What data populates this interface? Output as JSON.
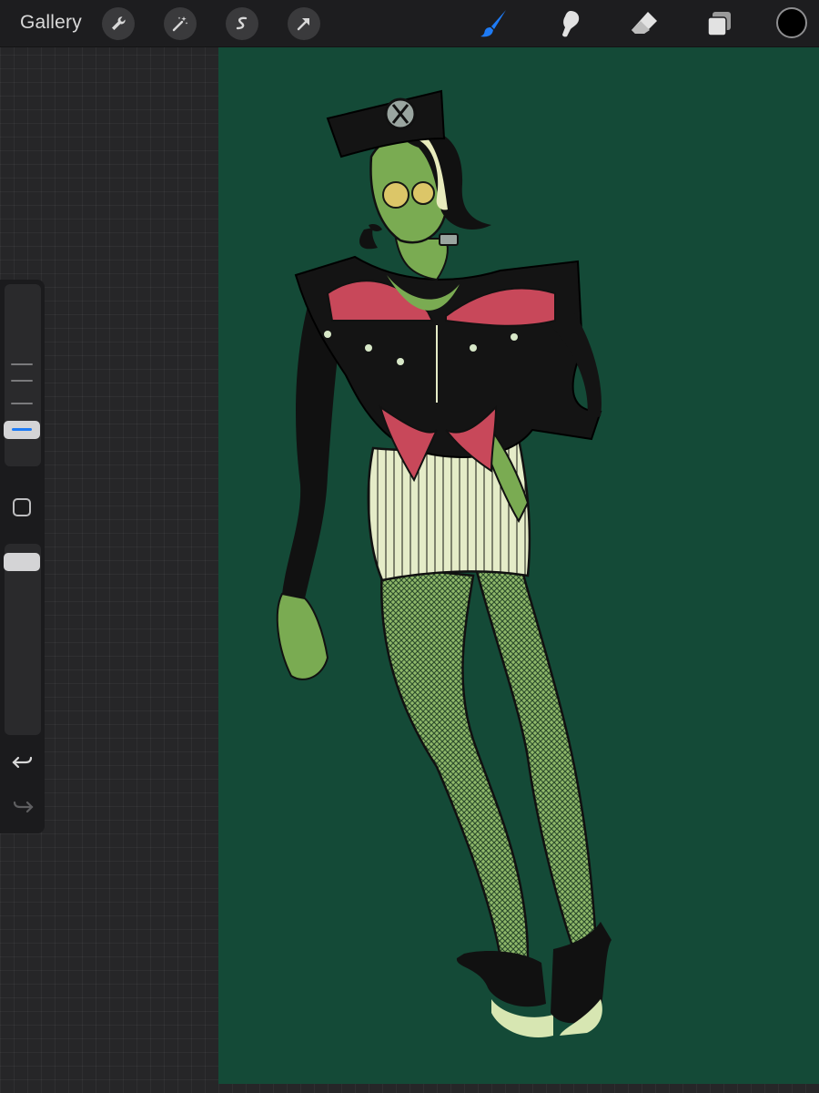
{
  "app": {
    "topbar": {
      "gallery_label": "Gallery",
      "left_tools": [
        "wrench-icon",
        "magic-wand-icon",
        "selection-icon",
        "transform-arrow-icon"
      ],
      "right_tools": [
        "brush-icon",
        "smudge-icon",
        "eraser-icon",
        "layers-icon"
      ],
      "active_tool": "brush-icon",
      "accent_color": "#1e7bf5",
      "current_color": "#000000"
    },
    "sidebar": {
      "brush_size_icon": "size-ticks",
      "opacity_icon": "opacity-slider",
      "modify_button": "square-icon",
      "undo_icon": "undo-arrow-icon",
      "redo_icon": "redo-arrow-icon"
    },
    "canvas": {
      "background_color": "#144a37",
      "artwork": "illustration-figure"
    }
  }
}
